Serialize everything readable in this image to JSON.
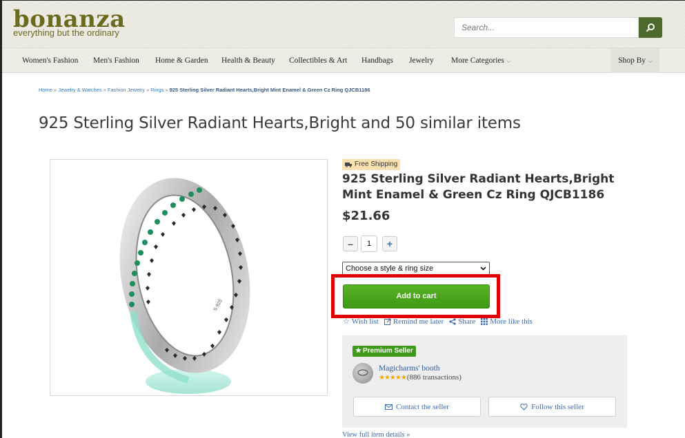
{
  "header": {
    "logo_word": "bonanza",
    "logo_tagline": "everything but the ordinary",
    "search_placeholder": "Search..."
  },
  "nav": {
    "items": [
      "Women's Fashion",
      "Men's Fashion",
      "Home & Garden",
      "Health & Beauty",
      "Collectibles & Art",
      "Handbags",
      "Jewelry",
      "More Categories"
    ],
    "shop_by": "Shop By"
  },
  "breadcrumb": {
    "items": [
      "Home",
      "Jewelry & Watches",
      "Fashion Jewelry",
      "Rings"
    ],
    "current": "925 Sterling Silver Radiant Hearts,Bright Mint Enamel & Green Cz Ring QJCB1186",
    "separator": "»"
  },
  "page_title": "925 Sterling Silver Radiant Hearts,Bright and 50 similar items",
  "product": {
    "free_shipping": "Free Shipping",
    "title": "925 Sterling Silver Radiant Hearts,Bright Mint Enamel & Green Cz Ring QJCB1186",
    "price": "$21.66",
    "quantity": "1",
    "style_select": "Choose a style & ring size",
    "add_to_cart": "Add to cart",
    "engraving": "S 925"
  },
  "actions": {
    "wish_list": "Wish list",
    "remind": "Remind me later",
    "share": "Share",
    "more_like": "More like this"
  },
  "seller": {
    "badge": "Premium Seller",
    "name": "Magicharms' booth",
    "transactions": "(886 transactions)",
    "stars": "★★★★★",
    "contact": "Contact the seller",
    "follow": "Follow this seller"
  },
  "full_details": "View full item details »",
  "colors": {
    "brand_olive": "#6b6a1f",
    "search_green": "#4c6a2c",
    "cart_green": "#4ea81d",
    "link_blue": "#3a6ab0",
    "highlight_red": "#e10000"
  }
}
